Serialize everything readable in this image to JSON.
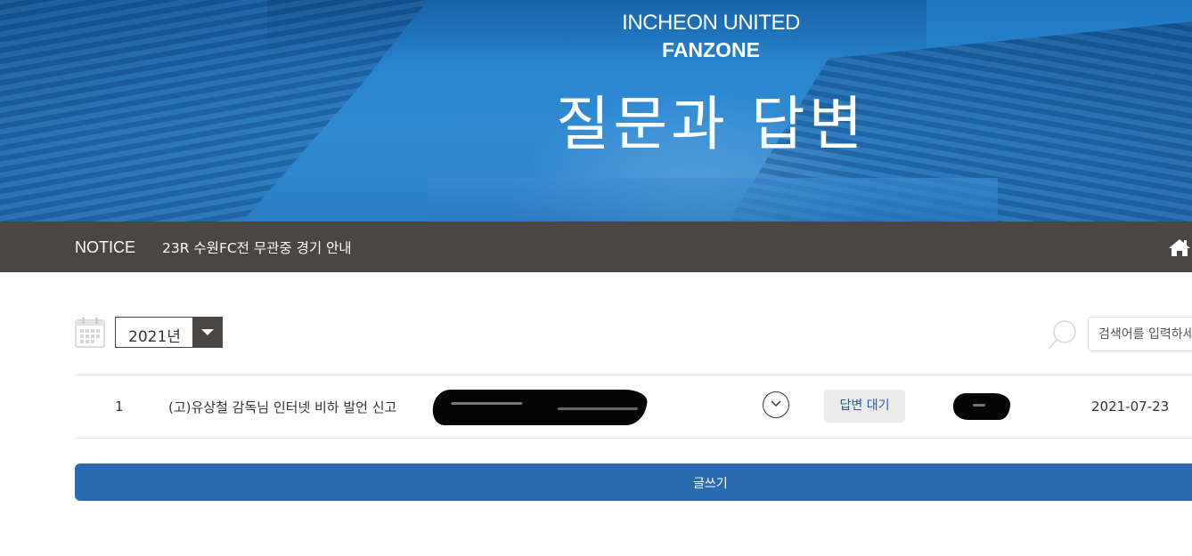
{
  "hero": {
    "club": "INCHEON UNITED",
    "fanzone": "FANZONE",
    "title": "질문과 답변"
  },
  "notice": {
    "label": "NOTICE",
    "text": "23R 수원FC전 무관중 경기 안내",
    "home_icon": "home-icon"
  },
  "filter": {
    "calendar_icon": "calendar-icon",
    "year_value": "2021년",
    "search_icon": "search-icon",
    "search_placeholder": "검색어를 입력하세요"
  },
  "list": {
    "rows": [
      {
        "number": "1",
        "title": "(고)유상철 감독님 인터넷 비하 발언 신고",
        "status": "답변 대기",
        "date": "2021-07-23"
      }
    ]
  },
  "actions": {
    "write_label": "글쓰기"
  },
  "colors": {
    "hero_blue": "#2a86cf",
    "notice_bg": "#4a4644",
    "write_button": "#2a6bb0",
    "status_text": "#2a5a96"
  }
}
